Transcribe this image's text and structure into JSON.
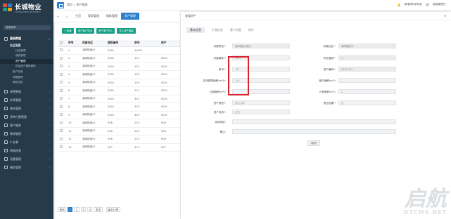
{
  "brand": {
    "name": "长城物业",
    "sub": "CHANGCHENG PROPERTY"
  },
  "sidebar": {
    "search_placeholder": "搜索菜单",
    "section": "基础数据",
    "group": "社区管理",
    "items": [
      "社区管理",
      "楼栋管理",
      "资产管理",
      "批量资产模板模板"
    ],
    "group_items": [
      "客户档案",
      "网格管理",
      "隐私信息"
    ],
    "menus": [
      "收费数据",
      "抄表管理",
      "物业管理",
      "多种付费管理",
      "客户服务",
      "装修管理",
      "4-办事",
      "网络巡查",
      "设备管理",
      "服务管理"
    ]
  },
  "topbar": {
    "crumb_home": "首页",
    "crumb_sep": "/",
    "crumb_current": "资产管理",
    "links": [
      "新增资料到项目",
      "",
      "超级管理员"
    ]
  },
  "tabs": {
    "items": [
      "主页",
      "管家管理",
      "楼栋管理",
      "资产管理"
    ]
  },
  "toolbar": {
    "buttons": [
      "+ 新增",
      "资产客户导出",
      "资产客户导入",
      "导入资产模板"
    ]
  },
  "table": {
    "headers": [
      "",
      "序号",
      "所属社区",
      "楼栋编号",
      "房号",
      "房产"
    ],
    "rows": [
      [
        "1",
        "演绎楼盘01",
        "0001",
        "10001",
        ""
      ],
      [
        "2",
        "演绎楼盘01",
        "0001",
        "101",
        "0001"
      ],
      [
        "3",
        "演绎楼盘01",
        "0001",
        "102",
        "0001"
      ],
      [
        "4",
        "演绎楼盘01",
        "0001",
        "103",
        "0001"
      ],
      [
        "5",
        "演绎楼盘01",
        "0001",
        "104",
        "0001"
      ],
      [
        "6",
        "演绎楼盘01",
        "0001",
        "225",
        "0001"
      ],
      [
        "7",
        "演绎楼盘01",
        "0001",
        "302",
        "0001"
      ],
      [
        "8",
        "演绎楼盘01",
        "0001",
        "303",
        "0001"
      ],
      [
        "9",
        "演绎楼盘01",
        "0001",
        "304",
        "0001"
      ],
      [
        "10",
        "演绎楼盘01",
        "006",
        "203",
        "006"
      ],
      [
        "11",
        "演绎楼盘01",
        "006",
        "205",
        "006"
      ],
      [
        "12",
        "演绎楼盘01",
        "006",
        "203",
        "006"
      ],
      [
        "13",
        "演绎楼盘01",
        "007",
        "314",
        "007"
      ]
    ]
  },
  "pager": {
    "first": "首页",
    "pages": [
      "1",
      "2",
      "3",
      "4"
    ],
    "last": "末页",
    "size": "每页15条"
  },
  "panel": {
    "title": "查看资产",
    "tabs": [
      "基本信息",
      "扩展信息",
      "客户档案",
      "附件"
    ],
    "fields": {
      "community_label": "所属项目*:",
      "community_value": "演绎楼盘(物业)",
      "area_label": "所属社区*:",
      "area_value": "演绎楼盘01",
      "building_label": "所属楼栋*:",
      "building_value": "0001",
      "unit_label": "所在楼层*:",
      "unit_value": "1",
      "room_label": "房号*:",
      "room_value": "101",
      "code_label": "资产编码*:",
      "code_value": "0001-101",
      "area1_label": "实用建筑面积(m²)*:",
      "area1_value": "100",
      "area2_label": "套内面积(m²):",
      "area2_value": "",
      "area3_label": "公摊面积(m²):",
      "area3_value": "",
      "area4_label": "计费面积(m²):",
      "area4_value": "0",
      "type_label": "资产类型*:",
      "type_value": "居住公寓",
      "free_label": "是否空置*:",
      "free_value": "否",
      "status_label": "资产状态*:",
      "status_value": "出售",
      "addr_label": "实际地址:",
      "addr_value": "",
      "note_label": "备注:",
      "note_value": ""
    },
    "cancel": "取消"
  },
  "watermark": {
    "w1": "启航",
    "w2": "DTCMS.NET"
  }
}
